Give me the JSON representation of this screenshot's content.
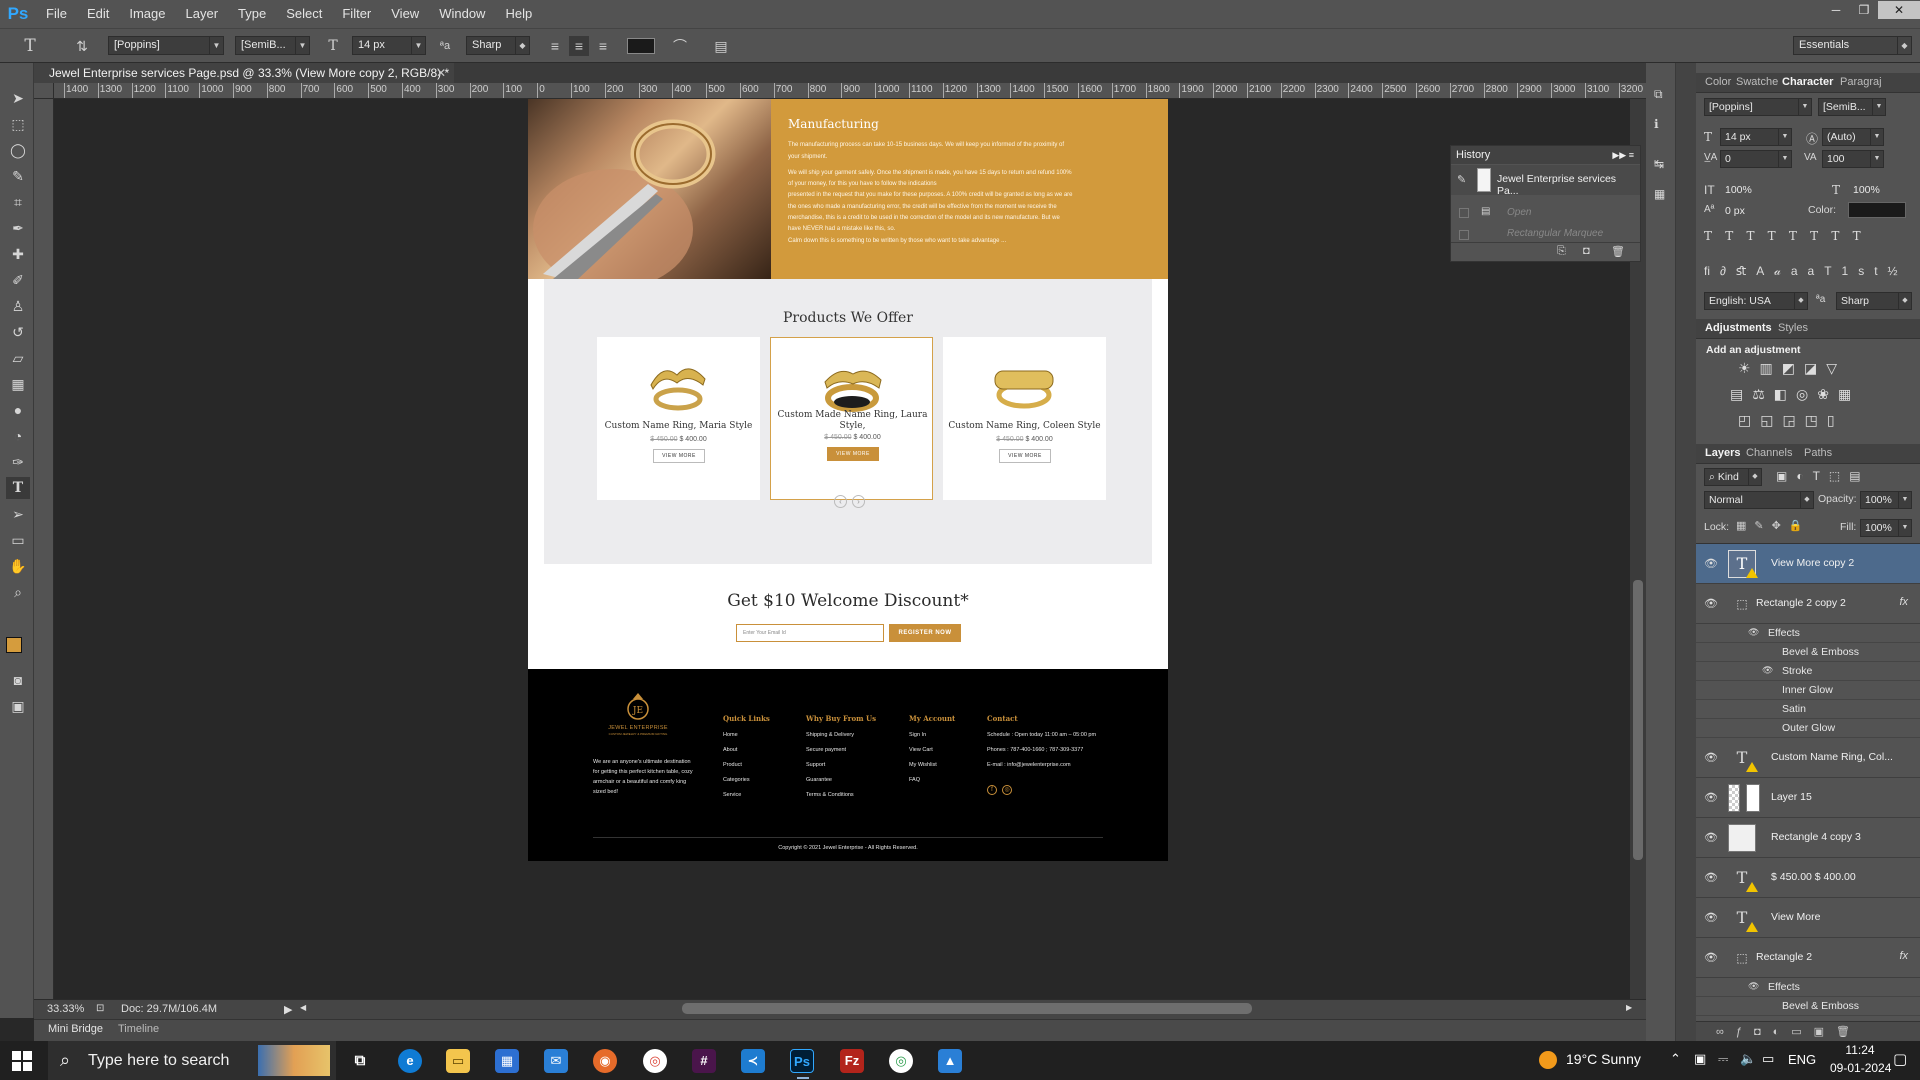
{
  "app": {
    "logo": "Ps",
    "menu": [
      "File",
      "Edit",
      "Image",
      "Layer",
      "Type",
      "Select",
      "Filter",
      "View",
      "Window",
      "Help"
    ]
  },
  "options_bar": {
    "font_family": "[Poppins]",
    "font_style": "[SemiB...",
    "font_size": "14 px",
    "antialias": "Sharp",
    "workspace": "Essentials",
    "text_color": "#1a1a1a"
  },
  "document": {
    "tab_title": "Jewel Enterprise services Page.psd @ 33.3% (View More copy 2, RGB/8) *",
    "ruler_labels": [
      "1400",
      "1300",
      "1200",
      "1100",
      "1000",
      "900",
      "800",
      "700",
      "600",
      "500",
      "400",
      "300",
      "200",
      "100",
      "0",
      "100",
      "200",
      "300",
      "400",
      "500",
      "600",
      "700",
      "800",
      "900",
      "1000",
      "1100",
      "1200",
      "1300",
      "1400",
      "1500",
      "1600",
      "1700",
      "1800",
      "1900",
      "2000",
      "2100",
      "2200",
      "2300",
      "2400",
      "2500",
      "2600",
      "2700",
      "2800",
      "2900",
      "3000",
      "3100",
      "3200"
    ],
    "zoom": "33.33%",
    "doc_size": "Doc: 29.7M/106.4M"
  },
  "bottom_tabs": [
    "Mini Bridge",
    "Timeline"
  ],
  "site": {
    "hero": {
      "title": "Manufacturing",
      "lines": [
        "The manufacturing process can take 10-15 business days. We will keep you informed of the proximity of",
        "your shipment.",
        "We will ship your garment safely. Once the shipment is made, you have 15 days to return and refund 100%",
        "of your money, for this you have to follow the indications",
        "presented in the request that you make for these purposes. A 100% credit will be granted as long as we are",
        "the ones who made a manufacturing error, the credit will be effective from the moment we receive the",
        "merchandise, this is a credit to be used in the correction of the model and its new manufacture. But we",
        "have NEVER had a mistake like this, so.",
        "Calm down this is something to be written by those who want to take advantage ..."
      ]
    },
    "products": {
      "title": "Products We Offer",
      "cards": [
        {
          "name": "Custom Name Ring, Maria Style",
          "old_price": "$ 450.00",
          "price": "$ 400.00",
          "button": "VIEW MORE",
          "ring_text": "Maria"
        },
        {
          "name": "Custom Made Name Ring, Laura Style,",
          "old_price": "$ 450.00",
          "price": "$ 400.00",
          "button": "VIEW MORE",
          "ring_text": "Laura"
        },
        {
          "name": "Custom Name Ring, Coleen Style",
          "old_price": "$ 450.00",
          "price": "$ 400.00",
          "button": "VIEW MORE",
          "ring_text": "Coleen"
        }
      ]
    },
    "discount": {
      "title": "Get $10 Welcome Discount*",
      "email_placeholder": "Enter Your Email Id",
      "button": "REGISTER NOW"
    },
    "footer": {
      "brand": "JEWEL ENTERPRISE",
      "tagline": "CUSTOM JEWELRY & PREMIUM GIFTING",
      "description": "We are an anyone's ultimate destination for getting this perfect kitchen table, cozy armchair or a beautiful and comfy king sized bed!",
      "columns": [
        {
          "title": "Quick Links",
          "items": [
            "Home",
            "About",
            "Product",
            "Categories",
            "Service"
          ]
        },
        {
          "title": "Why Buy From Us",
          "items": [
            "Shipping & Delivery",
            "Secure payment",
            "Support",
            "Guarantee",
            "Terms & Conditions"
          ]
        },
        {
          "title": "My Account",
          "items": [
            "Sign In",
            "View Cart",
            "My Wishlist",
            "FAQ"
          ]
        },
        {
          "title": "Contact",
          "items": [
            "Schedule : Open today 11:00 am – 05:00 pm",
            "Phones : 787-400-1660 ; 787-309-3377",
            "E-mail : info@jewelenterprise.com"
          ]
        }
      ],
      "copyright": "Copyright © 2021 Jewel Enterprise - All Rights Reserved."
    }
  },
  "history": {
    "title": "History",
    "items": [
      "Jewel Enterprise services Pa...",
      "Open",
      "Rectangular Marquee"
    ]
  },
  "character": {
    "tabs": [
      "Color",
      "Swatche",
      "Character",
      "Paragraj"
    ],
    "font_family": "[Poppins]",
    "font_style": "[SemiB...",
    "size": "14 px",
    "leading": "(Auto)",
    "kerning": "0",
    "tracking": "100",
    "vscale": "100%",
    "hscale": "100%",
    "baseline": "0 px",
    "color_label": "Color:",
    "language": "English: USA",
    "antialias": "Sharp"
  },
  "adjustments": {
    "tabs": [
      "Adjustments",
      "Styles"
    ],
    "heading": "Add an adjustment"
  },
  "layers": {
    "tabs": [
      "Layers",
      "Channels",
      "Paths"
    ],
    "filter": "Kind",
    "blend": "Normal",
    "opacity_label": "Opacity:",
    "opacity": "100%",
    "lock_label": "Lock:",
    "fill_label": "Fill:",
    "fill": "100%",
    "items": [
      {
        "name": "View More copy 2",
        "type": "text",
        "selected": true
      },
      {
        "name": "Rectangle 2 copy 2",
        "type": "shape",
        "fx": "fx"
      },
      {
        "name": "Effects",
        "type": "sub"
      },
      {
        "name": "Bevel & Emboss",
        "type": "sub"
      },
      {
        "name": "Stroke",
        "type": "sub"
      },
      {
        "name": "Inner Glow",
        "type": "sub"
      },
      {
        "name": "Satin",
        "type": "sub"
      },
      {
        "name": "Outer Glow",
        "type": "sub"
      },
      {
        "name": "Custom Name Ring, Col...",
        "type": "text"
      },
      {
        "name": "Layer 15",
        "type": "image"
      },
      {
        "name": "Rectangle 4 copy 3",
        "type": "shape"
      },
      {
        "name": "$ 450.00 $ 400.00",
        "type": "text"
      },
      {
        "name": "View More",
        "type": "text"
      },
      {
        "name": "Rectangle 2",
        "type": "shape",
        "fx": "fx"
      },
      {
        "name": "Effects",
        "type": "sub"
      },
      {
        "name": "Bevel & Emboss",
        "type": "sub"
      }
    ]
  },
  "taskbar": {
    "search_placeholder": "Type here to search",
    "weather": "19°C  Sunny",
    "lang": "ENG",
    "time": "11:24",
    "date": "09-01-2024"
  },
  "colors": {
    "accent_gold": "#c9903a",
    "hero_bg": "#d29a3c",
    "ps_blue": "#31a8ff",
    "layer_selected": "#4d6a8c"
  }
}
